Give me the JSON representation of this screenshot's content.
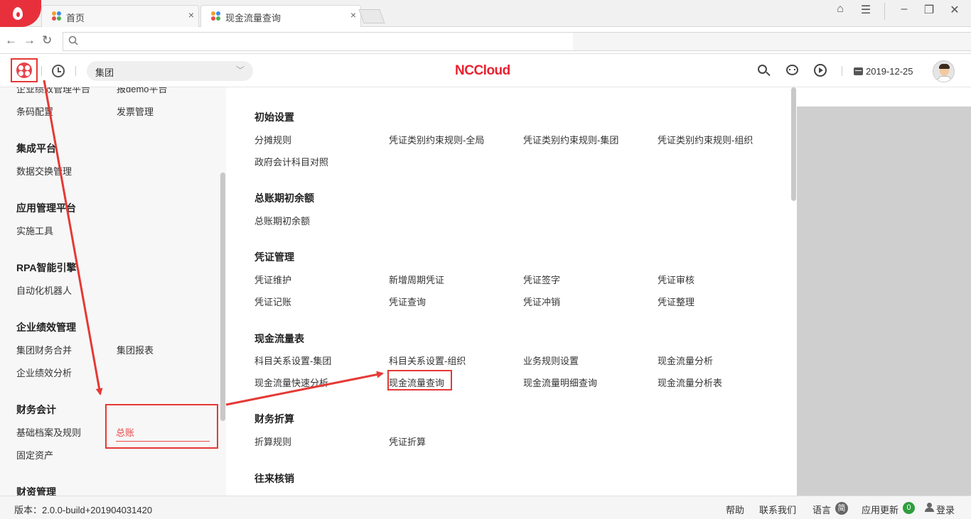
{
  "browser": {
    "tabs": [
      {
        "title": "首页"
      },
      {
        "title": "现金流量查询"
      }
    ],
    "close_glyph": "×",
    "url": ""
  },
  "header": {
    "org_select": {
      "value": "集团"
    },
    "brand": "NCCloud",
    "date": "2019-12-25"
  },
  "left_menu": {
    "partial_top": [
      "企业绩效管理平台",
      "报demo平台"
    ],
    "sections": [
      {
        "title": "",
        "items": [
          "条码配置",
          "发票管理"
        ]
      },
      {
        "title": "集成平台",
        "items": [
          "数据交换管理"
        ]
      },
      {
        "title": "应用管理平台",
        "items": [
          "实施工具"
        ]
      },
      {
        "title": "RPA智能引擎",
        "items": [
          "自动化机器人"
        ]
      },
      {
        "title": "企业绩效管理",
        "items": [
          "集团财务合并",
          "集团报表",
          "企业绩效分析"
        ]
      },
      {
        "title": "财务会计",
        "items": [
          "基础档案及规则",
          "总账",
          "固定资产"
        ]
      },
      {
        "title": "财资管理",
        "items": []
      }
    ]
  },
  "flyout": {
    "groups": [
      {
        "title": "初始设置",
        "items": [
          "分摊规则",
          "凭证类别约束规则-全局",
          "凭证类别约束规则-集团",
          "凭证类别约束规则-组织",
          "政府会计科目对照"
        ]
      },
      {
        "title": "总账期初余额",
        "items": [
          "总账期初余额"
        ]
      },
      {
        "title": "凭证管理",
        "items": [
          "凭证维护",
          "新增周期凭证",
          "凭证签字",
          "凭证审核",
          "凭证记账",
          "凭证查询",
          "凭证冲销",
          "凭证整理"
        ]
      },
      {
        "title": "现金流量表",
        "items": [
          "科目关系设置-集团",
          "科目关系设置-组织",
          "业务规则设置",
          "现金流量分析",
          "现金流量快速分析",
          "现金流量查询",
          "现金流量明细查询",
          "现金流量分析表"
        ]
      },
      {
        "title": "财务折算",
        "items": [
          "折算规则",
          "凭证折算"
        ]
      },
      {
        "title": "往来核销",
        "items": []
      }
    ]
  },
  "footer": {
    "version": "版本：2.0.0-build+201904031420",
    "help": "帮助",
    "contact": "联系我们",
    "language": "语言",
    "language_badge": "简",
    "updates": "应用更新",
    "updates_count": "0",
    "login": "登录"
  },
  "colors": {
    "brand_red": "#e8212e",
    "annotation_red": "#e53935",
    "active_item": "#e84a4a",
    "update_badge": "#2e9e3e"
  },
  "icons": [
    "browser-logo-icon",
    "favicon-icon",
    "back-icon",
    "forward-icon",
    "refresh-icon",
    "search-icon",
    "app-menu-icon",
    "history-clock-icon",
    "chevron-down-icon",
    "message-icon",
    "play-icon",
    "calendar-icon",
    "avatar",
    "user-icon"
  ]
}
